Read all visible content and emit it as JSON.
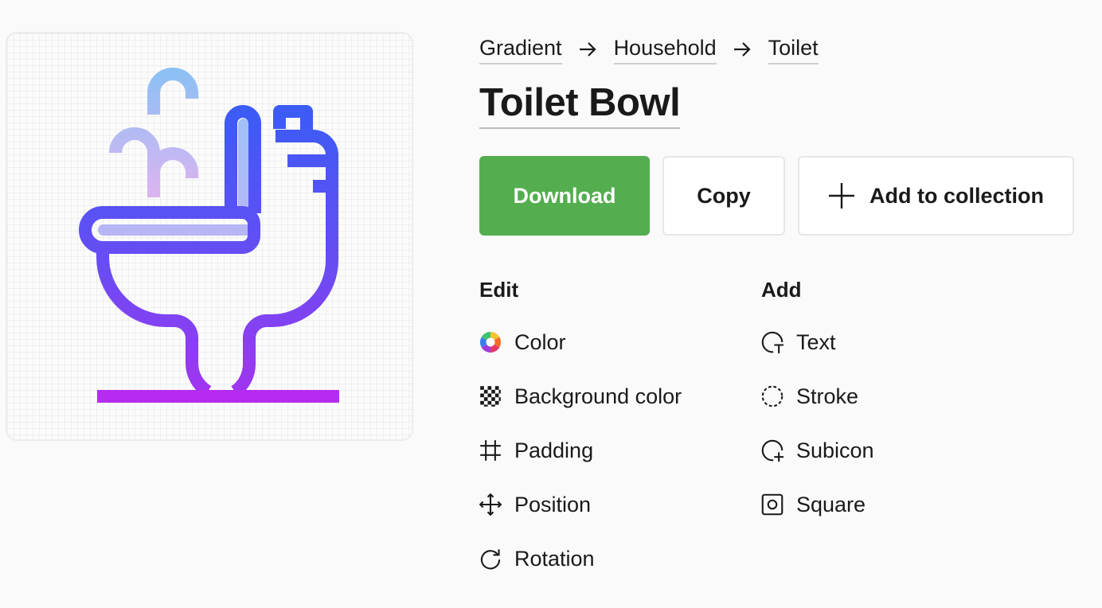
{
  "breadcrumb": [
    "Gradient",
    "Household",
    "Toilet"
  ],
  "title": "Toilet Bowl",
  "actions": {
    "download": "Download",
    "copy": "Copy",
    "add_to_collection": "Add to collection"
  },
  "edit": {
    "heading": "Edit",
    "items": [
      {
        "label": "Color",
        "icon": "color-wheel-icon"
      },
      {
        "label": "Background color",
        "icon": "checkerboard-icon"
      },
      {
        "label": "Padding",
        "icon": "padding-icon"
      },
      {
        "label": "Position",
        "icon": "move-arrows-icon"
      },
      {
        "label": "Rotation",
        "icon": "rotate-icon"
      }
    ]
  },
  "add": {
    "heading": "Add",
    "items": [
      {
        "label": "Text",
        "icon": "text-circle-icon"
      },
      {
        "label": "Stroke",
        "icon": "dashed-circle-icon"
      },
      {
        "label": "Subicon",
        "icon": "subicon-circle-icon"
      },
      {
        "label": "Square",
        "icon": "square-icon"
      }
    ]
  },
  "colors": {
    "download_bg": "#54ae4f",
    "icon_gradient_top": "#3a5cf5",
    "icon_gradient_bottom": "#b52cf0",
    "drop_gradient_top": "#8cc0f5",
    "drop_gradient_bottom": "#dfb4f0"
  },
  "preview_icon": "toilet-bowl-icon"
}
